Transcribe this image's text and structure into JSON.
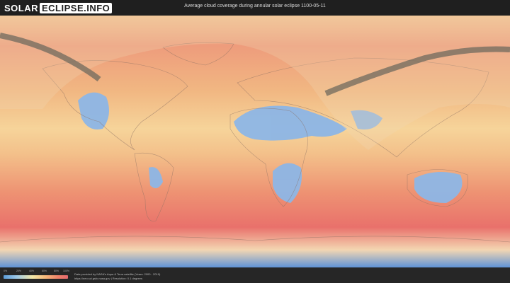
{
  "header": {
    "logo_part1": "SOLAR",
    "logo_part2": "ECLIPSE.INFO",
    "title": "Average cloud coverage during annular solar eclipse 1100-05-11"
  },
  "legend": {
    "ticks": [
      "0%",
      "20%",
      "40%",
      "60%",
      "80%",
      "100%"
    ],
    "colors": [
      "#5b9bd8",
      "#9cc8e6",
      "#f2e6a6",
      "#f6b87a",
      "#ee8068",
      "#e56a70"
    ]
  },
  "footer": {
    "credit_line1": "Data provided by NASA's Aqua & Terra satellite (Years: 2000 - 2019)",
    "credit_line2": "https://neo.sci.gsfc.nasa.gov | Resolution: 0.1 degrees"
  },
  "colors": {
    "ocean_cloudy": "#e97f6f",
    "mid": "#f3c28c",
    "clear": "#8fb5e6",
    "shadow_band": "#6f6a5e"
  }
}
